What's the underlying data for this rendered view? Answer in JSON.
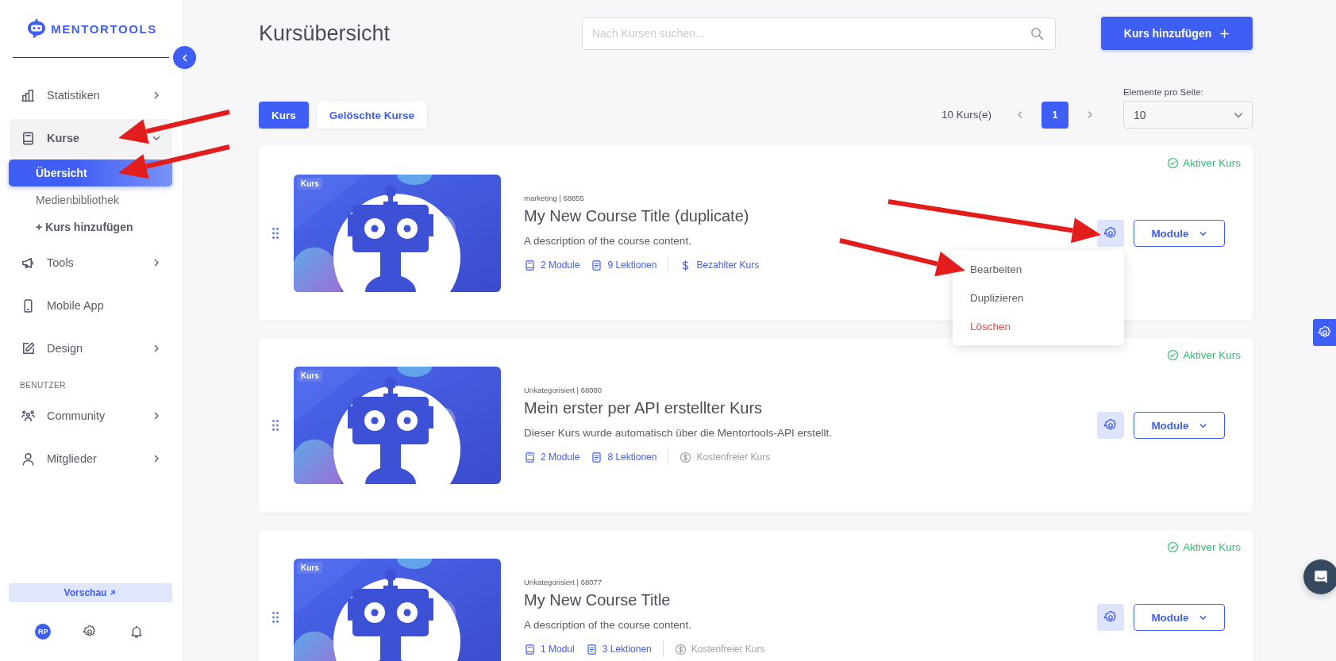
{
  "sidebar": {
    "logo": "MENTORTOOLS",
    "nav": [
      {
        "kind": "item",
        "label": "Statistiken",
        "expandable": true,
        "expanded": false,
        "pointed": false
      },
      {
        "kind": "item",
        "label": "Kurse",
        "expandable": true,
        "expanded": true,
        "pointed": true,
        "children": [
          {
            "label": "Übersicht",
            "kind": "link",
            "selected": true,
            "pointed": true
          },
          {
            "label": "Medienbibliothek",
            "kind": "link",
            "selected": false,
            "pointed": false
          },
          {
            "label": "+ Kurs hinzufügen",
            "kind": "action",
            "selected": false,
            "pointed": false
          }
        ]
      },
      {
        "kind": "item",
        "label": "Tools",
        "expandable": true,
        "expanded": false,
        "pointed": false
      },
      {
        "kind": "item",
        "label": "Mobile App",
        "expandable": false,
        "expanded": false,
        "pointed": false
      },
      {
        "kind": "item",
        "label": "Design",
        "expandable": true,
        "expanded": false,
        "pointed": false
      },
      {
        "kind": "heading",
        "label": "BENUTZER"
      },
      {
        "kind": "item",
        "label": "Community",
        "expandable": true,
        "expanded": false,
        "pointed": false
      },
      {
        "kind": "item",
        "label": "Mitglieder",
        "expandable": true,
        "expanded": false,
        "pointed": false
      }
    ],
    "preview_button": "Vorschau",
    "avatar": "RP"
  },
  "header": {
    "title": "Kursübersicht",
    "search": {
      "placeholder": "Nach Kursen suchen..."
    },
    "add_button": "Kurs hinzufügen"
  },
  "tabs": [
    {
      "label": "Kurs",
      "selected": true
    },
    {
      "label": "Gelöschte Kurse",
      "selected": false
    }
  ],
  "pagination": {
    "count": "10 Kurs(e)",
    "pages": [
      {
        "label": "1",
        "selected": true
      }
    ],
    "per_page_label": "Elemente pro Seite:",
    "per_page_value": "10"
  },
  "courses": [
    {
      "badge": "Kurs",
      "meta": "marketing | 68855",
      "title": "My New Course Title (duplicate)",
      "description": "A description of the course content.",
      "modules": "2 Module",
      "lessons": "9 Lektionen",
      "price": {
        "kind": "paid",
        "label": "Bezahlter Kurs"
      },
      "status": "Aktiver Kurs",
      "module_button": "Module",
      "settings_pointed": true,
      "settings_menu": [
        {
          "label": "Bearbeiten",
          "kind": "normal",
          "pointed": true
        },
        {
          "label": "Duplizieren",
          "kind": "normal",
          "pointed": false
        },
        {
          "label": "Löschen",
          "kind": "danger",
          "pointed": false
        }
      ]
    },
    {
      "badge": "Kurs",
      "meta": "Unkategorisiert | 68080",
      "title": "Mein erster per API erstellter Kurs",
      "description": "Dieser Kurs wurde automatisch über die Mentortools-API erstellt.",
      "modules": "2 Module",
      "lessons": "8 Lektionen",
      "price": {
        "kind": "free",
        "label": "Kostenfreier Kurs"
      },
      "status": "Aktiver Kurs",
      "module_button": "Module",
      "settings_pointed": false
    },
    {
      "badge": "Kurs",
      "meta": "Unkategorisiert | 68077",
      "title": "My New Course Title",
      "description": "A description of the course content.",
      "modules": "1 Modul",
      "lessons": "3 Lektionen",
      "price": {
        "kind": "free",
        "label": "Kostenfreier Kurs"
      },
      "status": "Aktiver Kurs",
      "module_button": "Module",
      "settings_pointed": false
    }
  ]
}
